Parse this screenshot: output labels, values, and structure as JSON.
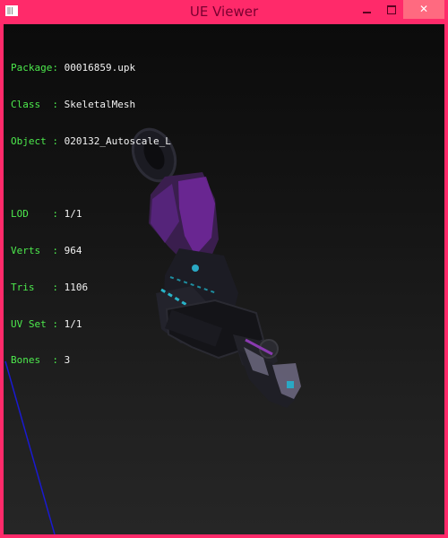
{
  "window": {
    "title": "UE Viewer",
    "accent_color": "#ff2a6a",
    "close_hover_color": "#ff6a80",
    "icon": "app-window-icon"
  },
  "controls": {
    "minimize_icon": "minimize-icon",
    "maximize_icon": "maximize-icon",
    "close_icon": "close-icon",
    "close_label": "✕"
  },
  "info": {
    "package_key": "Package:",
    "package_value": "00016859.upk",
    "class_key": "Class  :",
    "class_value": "SkeletalMesh",
    "object_key": "Object :",
    "object_value": "020132_Autoscale_L",
    "lod_key": "LOD    :",
    "lod_value": "1/1",
    "verts_key": "Verts  :",
    "verts_value": "964",
    "tris_key": "Tris   :",
    "tris_value": "1106",
    "uv_key": "UV Set :",
    "uv_value": "1/1",
    "bones_key": "Bones  :",
    "bones_value": "3",
    "label_color": "#4dea4d"
  },
  "viewport": {
    "axis_color": "#1a1ad0"
  }
}
